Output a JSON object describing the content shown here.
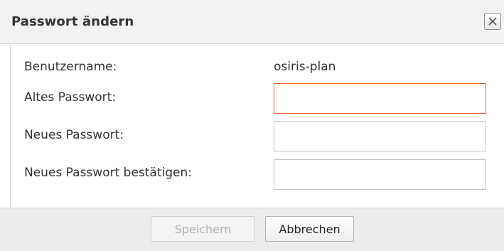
{
  "dialog": {
    "title": "Passwort ändern",
    "close_label": "×"
  },
  "form": {
    "username_label": "Benutzername:",
    "username_value": "osiris-plan",
    "old_password_label": "Altes Passwort:",
    "old_password_value": "",
    "new_password_label": "Neues Passwort:",
    "new_password_value": "",
    "confirm_password_label": "Neues Passwort bestätigen:",
    "confirm_password_value": ""
  },
  "footer": {
    "save_label": "Speichern",
    "save_enabled": false,
    "cancel_label": "Abbrechen"
  },
  "colors": {
    "focus_border": "#e05a30",
    "titlebar_bg": "#f2f2f2",
    "footer_bg": "#ececec"
  },
  "icons": {
    "close": "close-icon"
  }
}
